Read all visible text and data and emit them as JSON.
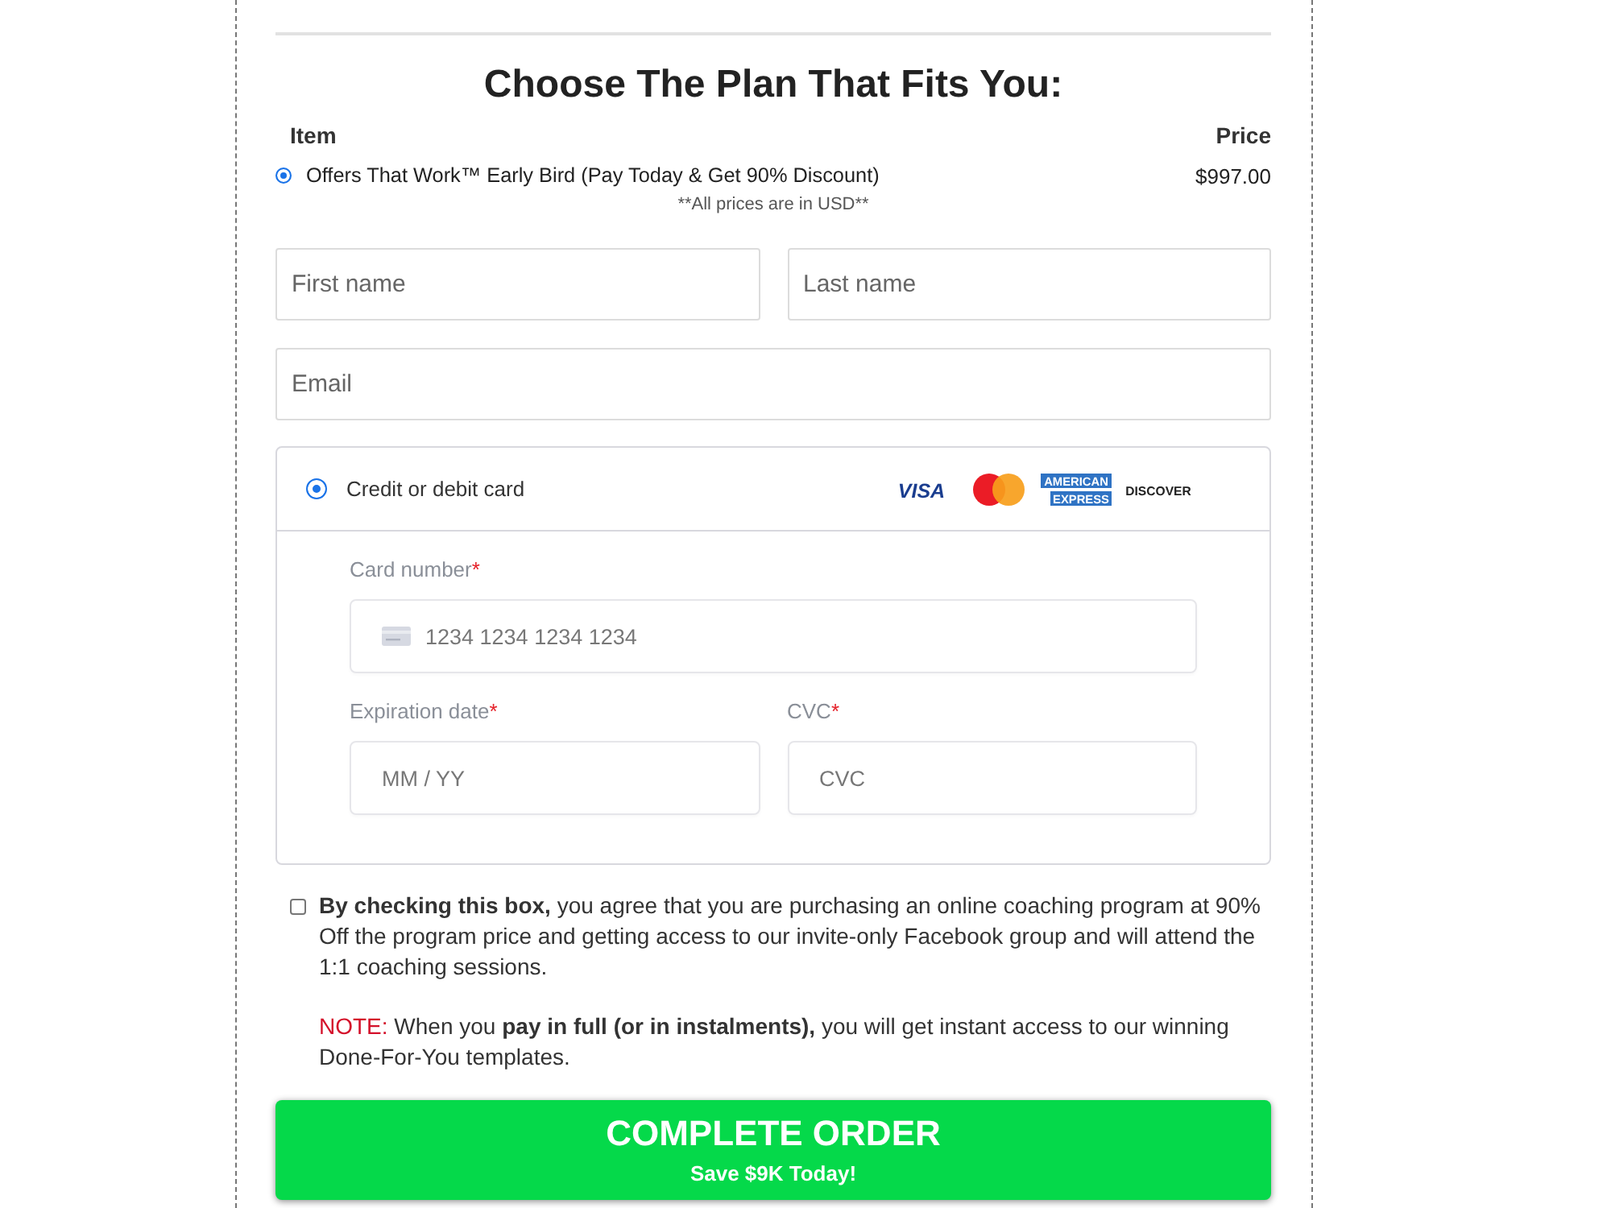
{
  "plan_section": {
    "title": "Choose The Plan That Fits You:",
    "columns": [
      "Item",
      "Price"
    ],
    "items": [
      {
        "label": "Offers That Work™ Early Bird (Pay Today & Get 90% Discount)",
        "price": "$997.00",
        "selected": true
      }
    ],
    "currency_note": "**All prices are in USD**"
  },
  "name_fields": [
    {
      "placeholder": "First name"
    },
    {
      "placeholder": "Last name"
    }
  ],
  "email_field": {
    "placeholder": "Email"
  },
  "payment": {
    "method": {
      "label": "Credit or debit card",
      "selected": true
    },
    "card_logos": [
      {
        "kind": "visa",
        "lines": [
          "VISA"
        ]
      },
      {
        "kind": "circles"
      },
      {
        "kind": "amex",
        "lines": [
          "AMERICAN",
          "EXPRESS"
        ]
      },
      {
        "kind": "discover",
        "lines": [
          "DISCOVER"
        ]
      }
    ],
    "fields": [
      {
        "kind": "card",
        "label": "Card number",
        "required_mark": "*",
        "placeholder": "1234 1234 1234 1234"
      },
      {
        "kind": "expiry",
        "label": "Expiration date",
        "required_mark": "*",
        "placeholder": "MM / YY"
      },
      {
        "kind": "cvc",
        "label": "CVC",
        "required_mark": "*",
        "placeholder": "CVC"
      }
    ]
  },
  "agreement": {
    "checked": false,
    "text": "**By checking this box,** you agree that you are purchasing an online coaching program at 90% Off the program price and getting access to our invite-only Facebook group and will attend the 1:1 coaching sessions.",
    "note_label": "NOTE:",
    "note": "When you **pay in full (or in instalments),** you will get instant access to our winning Done-For-You templates."
  },
  "submit_button": {
    "label": "COMPLETE ORDER",
    "sublabel": "Save $9K Today!"
  }
}
